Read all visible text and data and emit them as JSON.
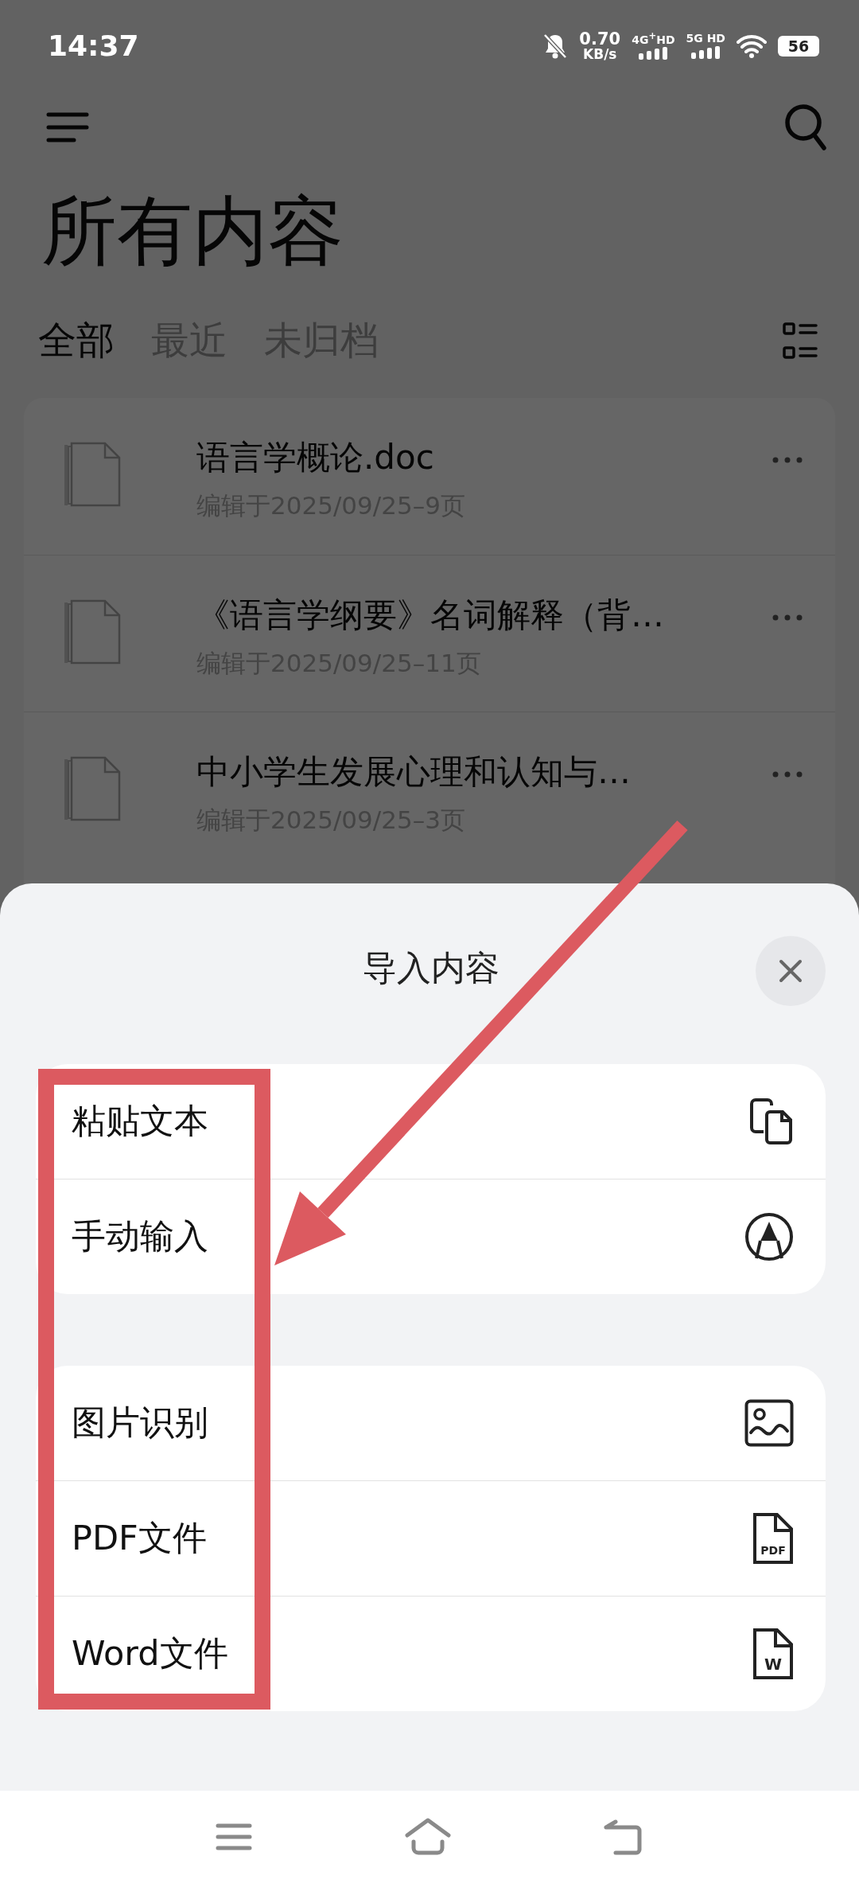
{
  "status_bar": {
    "time": "14:37",
    "speed": "0.70",
    "speed_unit": "KB/s",
    "sim1": "4G$^{+}$HD",
    "sim2": "5G HD",
    "battery": "56"
  },
  "header": {
    "title": "所有内容"
  },
  "tabs": [
    {
      "label": "全部",
      "selected": true
    },
    {
      "label": "最近",
      "selected": false
    },
    {
      "label": "未归档",
      "selected": false
    }
  ],
  "files": [
    {
      "name": "语言学概论.doc",
      "meta": "编辑于2025/09/25–9页"
    },
    {
      "name": "《语言学纲要》名词解释（背…",
      "meta": "编辑于2025/09/25–11页"
    },
    {
      "name": "中小学生发展心理和认知与…",
      "meta": "编辑于2025/09/25–3页"
    }
  ],
  "sheet": {
    "title": "导入内容",
    "groups": [
      [
        {
          "label": "粘贴文本",
          "kind": "copy"
        },
        {
          "label": "手动输入",
          "kind": "pen"
        }
      ],
      [
        {
          "label": "图片识别",
          "kind": "image"
        },
        {
          "label": "PDF文件",
          "kind": "pdf",
          "badge": "PDF"
        },
        {
          "label": "Word文件",
          "kind": "word",
          "badge": "W"
        }
      ]
    ]
  }
}
